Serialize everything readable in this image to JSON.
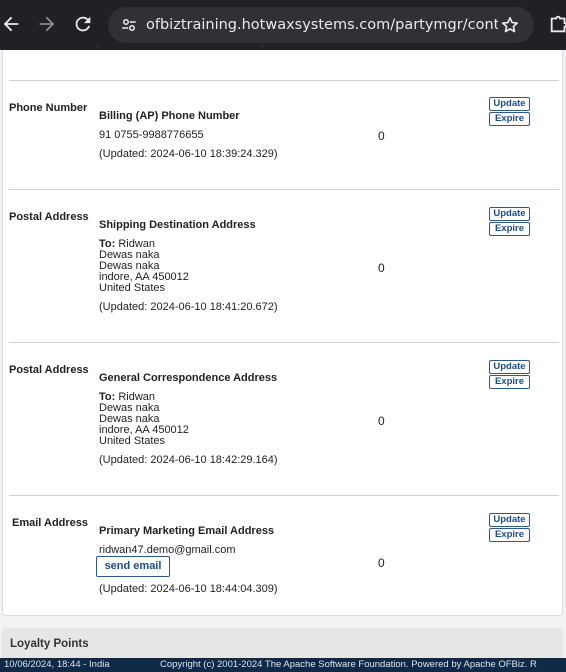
{
  "browser": {
    "url": "ofbiztraining.hotwaxsystems.com/partymgr/control/v…"
  },
  "contacts": [
    {
      "type_label": "Phone Number",
      "purpose": "Billing (AP) Phone Number",
      "lines": [
        "91 0755-9988776655"
      ],
      "updated": "(Updated: 2024-06-10 18:39:24.329)",
      "count": "0",
      "update_label": "Update",
      "expire_label": "Expire"
    },
    {
      "type_label": "Postal Address",
      "purpose": "Shipping Destination Address",
      "to_label": "To:",
      "to_name": "Ridwan",
      "lines": [
        "Dewas naka",
        "Dewas naka",
        "indore, AA 450012",
        "United States"
      ],
      "updated": "(Updated: 2024-06-10 18:41:20.672)",
      "count": "0",
      "update_label": "Update",
      "expire_label": "Expire"
    },
    {
      "type_label": "Postal Address",
      "purpose": "General Correspondence Address",
      "to_label": "To:",
      "to_name": "Ridwan",
      "lines": [
        "Dewas naka",
        "Dewas naka",
        "indore, AA 450012",
        "United States"
      ],
      "updated": "(Updated: 2024-06-10 18:42:29.164)",
      "count": "0",
      "update_label": "Update",
      "expire_label": "Expire"
    },
    {
      "type_label": "Email Address",
      "purpose": "Primary Marketing Email Address",
      "email": "ridwan47.demo@gmail.com",
      "send_email_label": "send email",
      "updated": "(Updated: 2024-06-10 18:44:04.309)",
      "count": "0",
      "update_label": "Update",
      "expire_label": "Expire"
    }
  ],
  "loyalty": {
    "title": "Loyalty Points"
  },
  "footer": {
    "left": "10/06/2024, 18:44 - India",
    "right": "Copyright (c) 2001-2024 The Apache Software Foundation. Powered by Apache OFBiz. R"
  }
}
